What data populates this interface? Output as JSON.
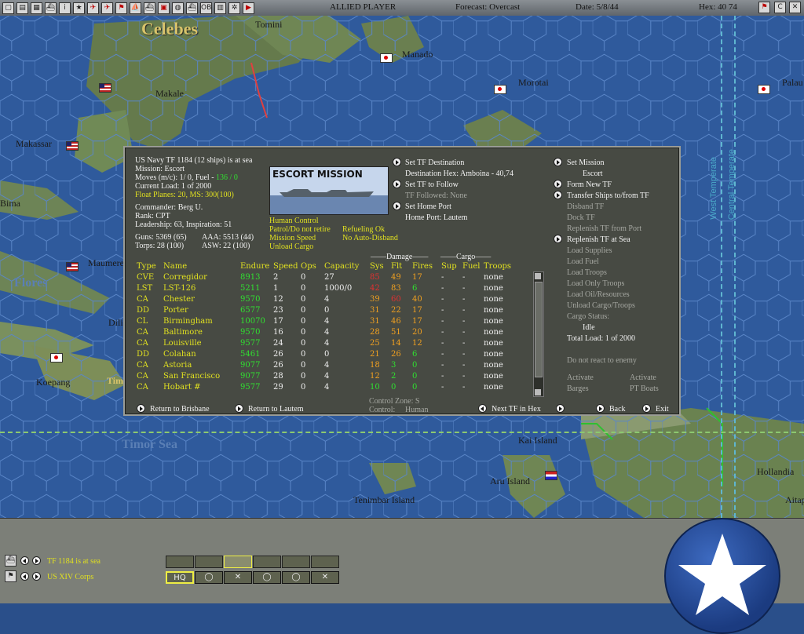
{
  "topbar": {
    "side": "ALLIED PLAYER",
    "forecast": "Forecast: Overcast",
    "date": "Date: 5/8/44",
    "hex": "Hex: 40 74",
    "buttons": [
      "square-icon",
      "doc-icon",
      "report-icon",
      "ship-icon",
      "info-icon",
      "star-icon",
      "plane-icon",
      "plane-icon",
      "flag-icon",
      "boat-icon",
      "ship-icon",
      "map-icon",
      "globe-icon",
      "ship-icon",
      "OB",
      "book-icon",
      "wheel-icon",
      "play-icon"
    ],
    "ob_label": "OB",
    "right_buttons": [
      "flag-icon",
      "C",
      "X"
    ]
  },
  "map": {
    "labels": {
      "celebes": "Celebes",
      "tomini": "Tomini",
      "manado": "Manado",
      "morotai": "Morotai",
      "palau": "Palau",
      "makale": "Makale",
      "makassar": "Makassar",
      "bima": "Bima",
      "maumere": "Maumere",
      "flores": "Flores",
      "dili": "Dili",
      "koepang": "Koepang",
      "timor": "Tim",
      "timor_sea": "Timor Sea",
      "kai_island": "Kai Island",
      "aru_island": "Aru Island",
      "tenimbar": "Tenimbar Island",
      "hollandia": "Hollandia",
      "aitape": "Aitap"
    },
    "zones": {
      "west": "West Temperate",
      "central": "Central Temperate"
    }
  },
  "panel": {
    "header": {
      "title": "US Navy TF 1184 (12 ships) is at sea",
      "mission": "Mission: Escort",
      "moves_prefix": "Moves (m/c): 1/ 0, Fuel - ",
      "fuel": "136 / 0",
      "load": "Current Load: 1 of 2000",
      "float_planes": "Float Planes: 20, MS: 300(100)",
      "commander": "Commander: Berg U.",
      "rank": "Rank: CPT",
      "leadership": "Leadership: 63, Inspiration: 51",
      "guns": "Guns: 5369 (65)",
      "aaa": "AAA: 5513 (44)",
      "torps": "Torps: 28 (100)",
      "asw": "ASW: 22 (100)"
    },
    "mission_image_title": "ESCORT MISSION",
    "options": {
      "human_control": "Human Control",
      "patrol": "Patrol/Do not retire",
      "refueling": "Refueling Ok",
      "mission_speed": "Mission Speed",
      "no_auto_disband": "No Auto-Disband",
      "unload_cargo": "Unload Cargo"
    },
    "middle": {
      "set_dest": "Set TF Destination",
      "dest_hex": "Destination Hex: Amboina - 40,74",
      "set_follow": "Set TF to Follow",
      "followed": "TF Followed: None",
      "set_home": "Set Home Port",
      "home_port": "Home Port: Lautem"
    },
    "right": {
      "set_mission": "Set Mission",
      "mission_value": "Escort",
      "form_new": "Form New TF",
      "transfer": "Transfer Ships to/from TF",
      "disband": "Disband TF",
      "dock": "Dock TF",
      "replenish_port": "Replenish TF from Port",
      "replenish_sea": "Replenish TF at Sea",
      "load_supplies": "Load Supplies",
      "load_fuel": "Load Fuel",
      "load_troops": "Load Troops",
      "load_only_troops": "Load Only Troops",
      "load_oil": "Load Oil/Resources",
      "unload_cargo": "Unload Cargo/Troops",
      "cargo_status": "Cargo Status:",
      "cargo_value": "Idle",
      "total_load": "Total Load: 1 of 2000",
      "no_react": "Do not react to enemy",
      "activate1": "Activate",
      "barges": "Barges",
      "activate2": "Activate",
      "pt_boats": "PT Boats"
    },
    "table": {
      "damage_group": "Damage",
      "cargo_group": "Cargo",
      "headers": {
        "type": "Type",
        "name": "Name",
        "endure": "Endure",
        "speed": "Speed",
        "ops": "Ops",
        "capacity": "Capacity",
        "sys": "Sys",
        "flt": "Flt",
        "fires": "Fires",
        "sup": "Sup",
        "fuel": "Fuel",
        "troops": "Troops"
      },
      "rows": [
        {
          "type": "CVE",
          "name": "Corregidor",
          "endure": "8913",
          "speed": "2",
          "ops": "0",
          "capacity": "27",
          "sys": "85",
          "flt": "49",
          "fires": "17",
          "sup": "-",
          "fuel": "-",
          "troops": "none"
        },
        {
          "type": "LST",
          "name": "LST-126",
          "endure": "5211",
          "speed": "1",
          "ops": "0",
          "capacity": "1000/0",
          "sys": "42",
          "flt": "83",
          "fires": "6",
          "sup": "-",
          "fuel": "-",
          "troops": "none"
        },
        {
          "type": "CA",
          "name": "Chester",
          "endure": "9570",
          "speed": "12",
          "ops": "0",
          "capacity": "4",
          "sys": "39",
          "flt": "60",
          "fires": "40",
          "sup": "-",
          "fuel": "-",
          "troops": "none"
        },
        {
          "type": "DD",
          "name": "Porter",
          "endure": "6577",
          "speed": "23",
          "ops": "0",
          "capacity": "0",
          "sys": "31",
          "flt": "22",
          "fires": "17",
          "sup": "-",
          "fuel": "-",
          "troops": "none"
        },
        {
          "type": "CL",
          "name": "Birmingham",
          "endure": "10070",
          "speed": "17",
          "ops": "0",
          "capacity": "4",
          "sys": "31",
          "flt": "46",
          "fires": "17",
          "sup": "-",
          "fuel": "-",
          "troops": "none"
        },
        {
          "type": "CA",
          "name": "Baltimore",
          "endure": "9570",
          "speed": "16",
          "ops": "0",
          "capacity": "4",
          "sys": "28",
          "flt": "51",
          "fires": "20",
          "sup": "-",
          "fuel": "-",
          "troops": "none"
        },
        {
          "type": "CA",
          "name": "Louisville",
          "endure": "9577",
          "speed": "24",
          "ops": "0",
          "capacity": "4",
          "sys": "25",
          "flt": "14",
          "fires": "12",
          "sup": "-",
          "fuel": "-",
          "troops": "none"
        },
        {
          "type": "DD",
          "name": "Colahan",
          "endure": "5461",
          "speed": "26",
          "ops": "0",
          "capacity": "0",
          "sys": "21",
          "flt": "26",
          "fires": "6",
          "sup": "-",
          "fuel": "-",
          "troops": "none"
        },
        {
          "type": "CA",
          "name": "Astoria",
          "endure": "9077",
          "speed": "26",
          "ops": "0",
          "capacity": "4",
          "sys": "18",
          "flt": "3",
          "fires": "0",
          "sup": "-",
          "fuel": "-",
          "troops": "none"
        },
        {
          "type": "CA",
          "name": "San Francisco",
          "endure": "9077",
          "speed": "28",
          "ops": "0",
          "capacity": "4",
          "sys": "12",
          "flt": "2",
          "fires": "0",
          "sup": "-",
          "fuel": "-",
          "troops": "none"
        },
        {
          "type": "CA",
          "name": "Hobart #",
          "endure": "9577",
          "speed": "29",
          "ops": "0",
          "capacity": "4",
          "sys": "10",
          "flt": "0",
          "fires": "0",
          "sup": "-",
          "fuel": "-",
          "troops": "none"
        }
      ],
      "row_colors": {
        "sys": [
          "r",
          "r",
          "o",
          "o",
          "o",
          "o",
          "o",
          "o",
          "o",
          "o",
          "g"
        ],
        "flt": [
          "o",
          "o",
          "r",
          "o",
          "o",
          "o",
          "o",
          "o",
          "g",
          "g",
          "g"
        ],
        "fires": [
          "o",
          "g",
          "o",
          "o",
          "o",
          "o",
          "o",
          "g",
          "g",
          "g",
          "g"
        ]
      }
    },
    "control_zone": "Control Zone: S",
    "control": "Control:",
    "control_value": "Human",
    "footer": {
      "return_brisbane": "Return to Brisbane",
      "return_lautem": "Return to Lautem",
      "next_tf": "Next TF in Hex",
      "back": "Back",
      "exit": "Exit"
    }
  },
  "bottom": {
    "tf_status": "TF 1184 is at sea",
    "corps": "US XIV Corps",
    "hq_label": "HQ"
  },
  "colors": {
    "panel_bg": "#474a43",
    "yellow": "#e0e020",
    "green": "#30e030",
    "red": "#e03030",
    "orange": "#f0a020"
  }
}
